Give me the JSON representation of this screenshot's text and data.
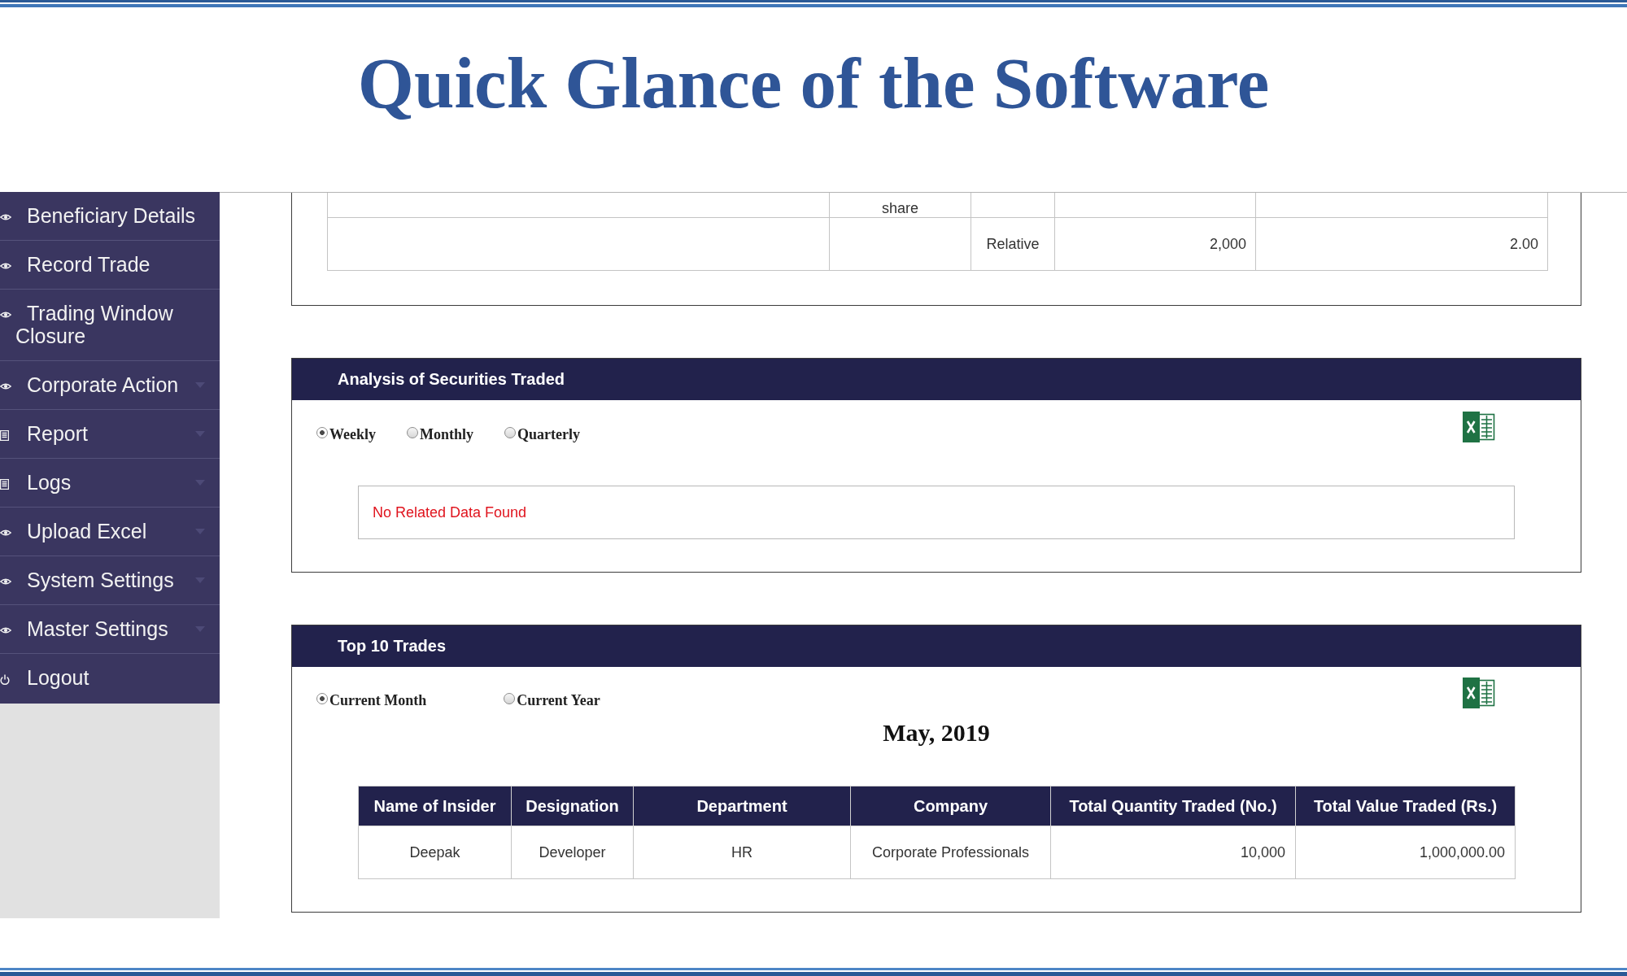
{
  "slide_title": "Quick Glance of the Software",
  "sidebar": {
    "items": [
      {
        "label": "Beneficiary Details",
        "kind": "page",
        "has_submenu": false
      },
      {
        "label": "Record Trade",
        "kind": "page",
        "has_submenu": false
      },
      {
        "label": "Trading Window Closure",
        "kind": "page",
        "has_submenu": false
      },
      {
        "label": "Corporate Action",
        "kind": "page",
        "has_submenu": true
      },
      {
        "label": "Report",
        "kind": "report",
        "has_submenu": true
      },
      {
        "label": "Logs",
        "kind": "report",
        "has_submenu": true
      },
      {
        "label": "Upload Excel",
        "kind": "page",
        "has_submenu": true
      },
      {
        "label": "System Settings",
        "kind": "page",
        "has_submenu": true
      },
      {
        "label": "Master Settings",
        "kind": "page",
        "has_submenu": true
      },
      {
        "label": "Logout",
        "kind": "logout",
        "has_submenu": false
      }
    ]
  },
  "holdings_table": {
    "rows": [
      {
        "column_2": "share"
      },
      {
        "column_3": "Relative",
        "column_4": "2,000",
        "column_5": "2.00"
      }
    ]
  },
  "analysis_panel": {
    "title": "Analysis of Securities Traded",
    "period_options": [
      {
        "label": "Weekly",
        "selected": true
      },
      {
        "label": "Monthly",
        "selected": false
      },
      {
        "label": "Quarterly",
        "selected": false
      }
    ],
    "message": "No Related Data Found"
  },
  "top_trades_panel": {
    "title": "Top 10 Trades",
    "period_options": [
      {
        "label": "Current Month",
        "selected": true
      },
      {
        "label": "Current Year",
        "selected": false
      }
    ],
    "period_heading": "May, 2019",
    "table": {
      "columns": [
        "Name of Insider",
        "Designation",
        "Department",
        "Company",
        "Total Quantity Traded (No.)",
        "Total Value Traded (Rs.)"
      ],
      "rows": [
        [
          "Deepak",
          "Developer",
          "HR",
          "Corporate Professionals",
          "10,000",
          "1,000,000.00"
        ]
      ]
    }
  }
}
